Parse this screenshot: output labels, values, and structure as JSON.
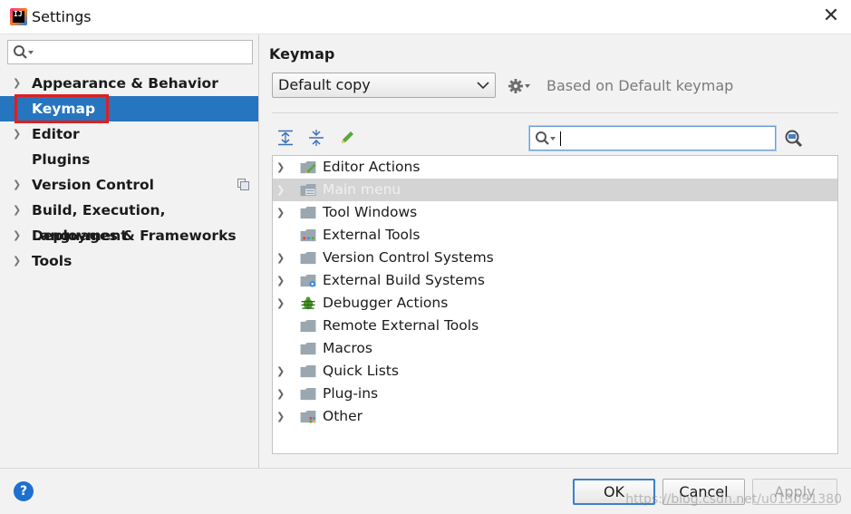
{
  "window": {
    "title": "Settings",
    "app_icon": "intellij-idea-icon",
    "app_icon_text": "IJ"
  },
  "sidebar": {
    "search_value": "",
    "items": [
      {
        "label": "Appearance & Behavior",
        "expandable": true
      },
      {
        "label": "Keymap",
        "expandable": false,
        "selected": true
      },
      {
        "label": "Editor",
        "expandable": true
      },
      {
        "label": "Plugins",
        "expandable": false
      },
      {
        "label": "Version Control",
        "expandable": true,
        "has_project_icon": true
      },
      {
        "label": "Build, Execution, Deployment",
        "expandable": true
      },
      {
        "label": "Languages & Frameworks",
        "expandable": true
      },
      {
        "label": "Tools",
        "expandable": true
      }
    ]
  },
  "main": {
    "title": "Keymap",
    "keymap_select": {
      "value": "Default copy"
    },
    "based_on": "Based on Default keymap",
    "toolbar": [
      "expand-all-icon",
      "collapse-all-icon",
      "edit-pencil-icon"
    ],
    "search_value": "",
    "tree": [
      {
        "label": "Editor Actions",
        "expandable": true,
        "icon": "editor-actions-icon"
      },
      {
        "label": "Main menu",
        "expandable": true,
        "icon": "main-menu-icon",
        "highlighted": true
      },
      {
        "label": "Tool Windows",
        "expandable": true,
        "icon": "folder-icon"
      },
      {
        "label": "External Tools",
        "expandable": false,
        "icon": "external-tools-icon"
      },
      {
        "label": "Version Control Systems",
        "expandable": true,
        "icon": "folder-icon"
      },
      {
        "label": "External Build Systems",
        "expandable": true,
        "icon": "build-gear-folder-icon"
      },
      {
        "label": "Debugger Actions",
        "expandable": true,
        "icon": "bug-icon"
      },
      {
        "label": "Remote External Tools",
        "expandable": false,
        "icon": "folder-icon"
      },
      {
        "label": "Macros",
        "expandable": false,
        "icon": "folder-icon"
      },
      {
        "label": "Quick Lists",
        "expandable": true,
        "icon": "folder-icon"
      },
      {
        "label": "Plug-ins",
        "expandable": true,
        "icon": "folder-icon"
      },
      {
        "label": "Other",
        "expandable": true,
        "icon": "other-folder-icon"
      }
    ]
  },
  "buttons": {
    "ok": "OK",
    "cancel": "Cancel",
    "apply": "Apply",
    "apply_enabled": false
  },
  "watermark": "https://blog.csdn.net/u013091380",
  "colors": {
    "selection": "#2675bf",
    "highlight_box": "#e01e1e",
    "help": "#1f6fd0"
  }
}
